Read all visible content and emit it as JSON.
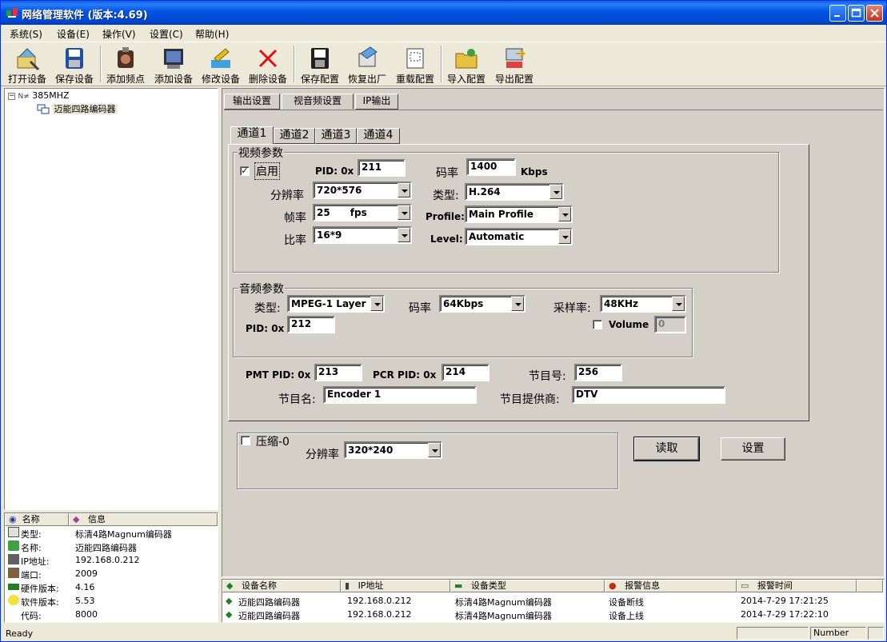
{
  "window": {
    "title": "网络管理软件 (版本:4.69)"
  },
  "menu": [
    "系统(S)",
    "设备(E)",
    "操作(V)",
    "设置(C)",
    "帮助(H)"
  ],
  "toolbar": [
    "打开设备",
    "保存设备",
    "添加频点",
    "添加设备",
    "修改设备",
    "删除设备",
    "保存配置",
    "恢复出厂",
    "重载配置",
    "导入配置",
    "导出配置"
  ],
  "tree": {
    "root": "385MHZ",
    "child": "迈能四路编码器"
  },
  "info": {
    "headers": [
      "名称",
      "信息"
    ],
    "rows": [
      {
        "k": "类型:",
        "v": "标清4路Magnum编码器"
      },
      {
        "k": "名称:",
        "v": "迈能四路编码器"
      },
      {
        "k": "IP地址:",
        "v": "192.168.0.212"
      },
      {
        "k": "端口:",
        "v": "2009"
      },
      {
        "k": "硬件版本:",
        "v": "4.16"
      },
      {
        "k": "软件版本:",
        "v": "5.53"
      },
      {
        "k": "代码:",
        "v": "8000"
      }
    ]
  },
  "tabs": [
    "输出设置",
    "视音频设置",
    "IP输出"
  ],
  "channels": [
    "通道1",
    "通道2",
    "通道3",
    "通道4"
  ],
  "video": {
    "group": "视频参数",
    "enable_label": "启用",
    "enable_check": "✓",
    "pid_label": "PID: 0x",
    "pid": "211",
    "bitrate_label": "码率",
    "bitrate": "1400",
    "bitrate_unit": "Kbps",
    "res_label": "分辨率",
    "res": "720*576",
    "type_label": "类型:",
    "type": "H.264",
    "fps_label": "帧率",
    "fps": "25      fps",
    "profile_label": "Profile:",
    "profile": "Main Profile",
    "aspect_label": "比率",
    "aspect": "16*9",
    "level_label": "Level:",
    "level": "Automatic"
  },
  "audio": {
    "group": "音频参数",
    "type_label": "类型:",
    "type": "MPEG-1 Layer",
    "bitrate_label": "码率",
    "bitrate": "64Kbps",
    "sr_label": "采样率:",
    "sr": "48KHz",
    "pid_label": "PID: 0x",
    "pid": "212",
    "volume_label": "Volume",
    "volume": "0"
  },
  "program": {
    "pmt_label": "PMT PID: 0x",
    "pmt": "213",
    "pcr_label": "PCR PID: 0x",
    "pcr": "214",
    "num_label": "节目号:",
    "num": "256",
    "name_label": "节目名:",
    "name": "Encoder 1",
    "provider_label": "节目提供商:",
    "provider": "DTV"
  },
  "compress": {
    "label": "压缩-0",
    "res_label": "分辨率",
    "res": "320*240"
  },
  "buttons": {
    "read": "读取",
    "set": "设置"
  },
  "log": {
    "headers": [
      "设备名称",
      "IP地址",
      "设备类型",
      "报警信息",
      "报警时间"
    ],
    "rows": [
      [
        "迈能四路编码器",
        "192.168.0.212",
        "标清4路Magnum编码器",
        "设备断线",
        "2014-7-29 17:21:25"
      ],
      [
        "迈能四路编码器",
        "192.168.0.212",
        "标清4路Magnum编码器",
        "设备上线",
        "2014-7-29 17:22:10"
      ]
    ]
  },
  "status": {
    "text": "Ready",
    "num": "Number"
  },
  "colors": {
    "titlebar": "#0054e3",
    "face": "#d4d0c8",
    "menu": "#ece9d8"
  }
}
